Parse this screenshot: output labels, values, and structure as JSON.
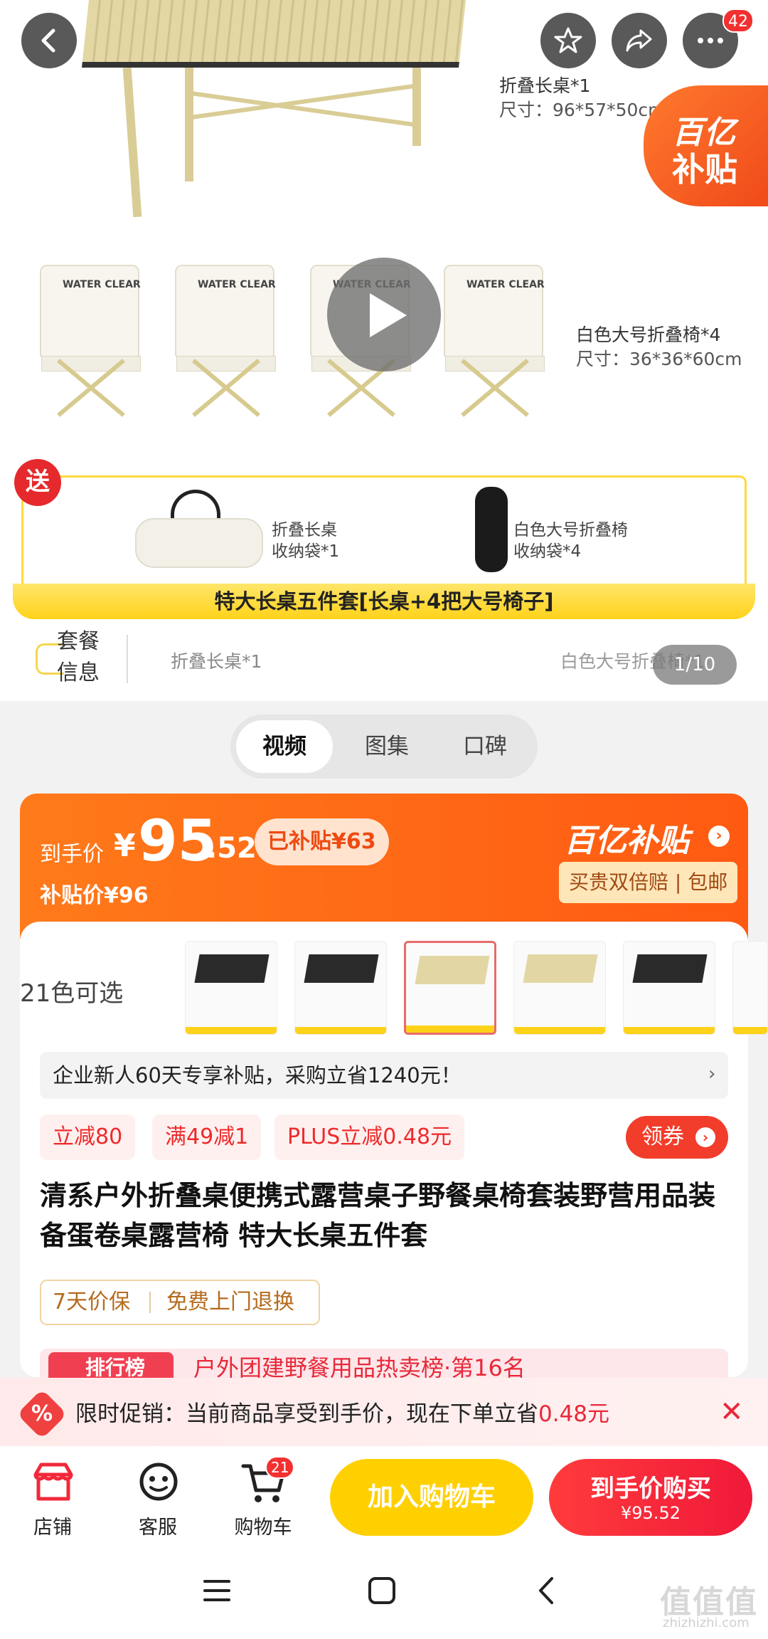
{
  "header": {
    "cart_badge_top": "42"
  },
  "hero": {
    "table_caption_line1": "折叠长桌*1",
    "table_caption_line2": "尺寸：96*57*50cm",
    "chair_caption_line1": "白色大号折叠椅*4",
    "chair_caption_line2": "尺寸：36*36*60cm",
    "chair_logo": "WATER CLEAR",
    "subsidy_line1": "百亿",
    "subsidy_line2": "补贴",
    "gift_label": "送",
    "gift1_line1": "折叠长桌",
    "gift1_line2": "收纳袋*1",
    "gift2_line1": "白色大号折叠椅",
    "gift2_line2": "收纳袋*4",
    "set_banner": "特大长桌五件套[长桌+4把大号椅子]",
    "package_title_line1": "套餐",
    "package_title_line2": "信息",
    "package_item1": "折叠长桌*1",
    "package_item2": "白色大号折叠椅*1",
    "image_counter": "1/10"
  },
  "media_tabs": [
    "视频",
    "图集",
    "口碑"
  ],
  "price": {
    "label": "到手价",
    "currency": "¥",
    "integer": "95",
    "decimal": ".52",
    "already_subsidized": "已补贴¥63",
    "subsidy_price": "补贴价¥96",
    "brand": "百亿补贴",
    "guarantee": "买贵双倍赔 | 包邮"
  },
  "colors": {
    "count_label": "21色可选"
  },
  "promo_banner": "企业新人60天专享补贴，采购立省1240元！",
  "coupons": [
    "立减80",
    "满49减1",
    "PLUS立减0.48元"
  ],
  "get_coupon": "领券",
  "product_title": "清系户外折叠桌便携式露营桌子野餐桌椅套装野营用品装备蛋卷桌露营椅 特大长桌五件套",
  "services": [
    "7天价保",
    "免费上门退换"
  ],
  "rank": {
    "badge": "排行榜",
    "text": "户外团建野餐用品热卖榜·第16名"
  },
  "limited": {
    "text_prefix": "限时促销：当前商品享受到手价，现在下单立省",
    "amount": "0.48元"
  },
  "bottom_bar": {
    "shop": "店铺",
    "service": "客服",
    "cart": "购物车",
    "cart_badge": "21",
    "add_to_cart": "加入购物车",
    "buy_line1": "到手价购买",
    "buy_line2": "¥95.52"
  },
  "watermark": {
    "main": "值值值",
    "sub": "zhizhizhi.com"
  },
  "accent_colors": {
    "orange": "#ff5a12",
    "red": "#f23d2b",
    "yellow": "#ffd000"
  }
}
